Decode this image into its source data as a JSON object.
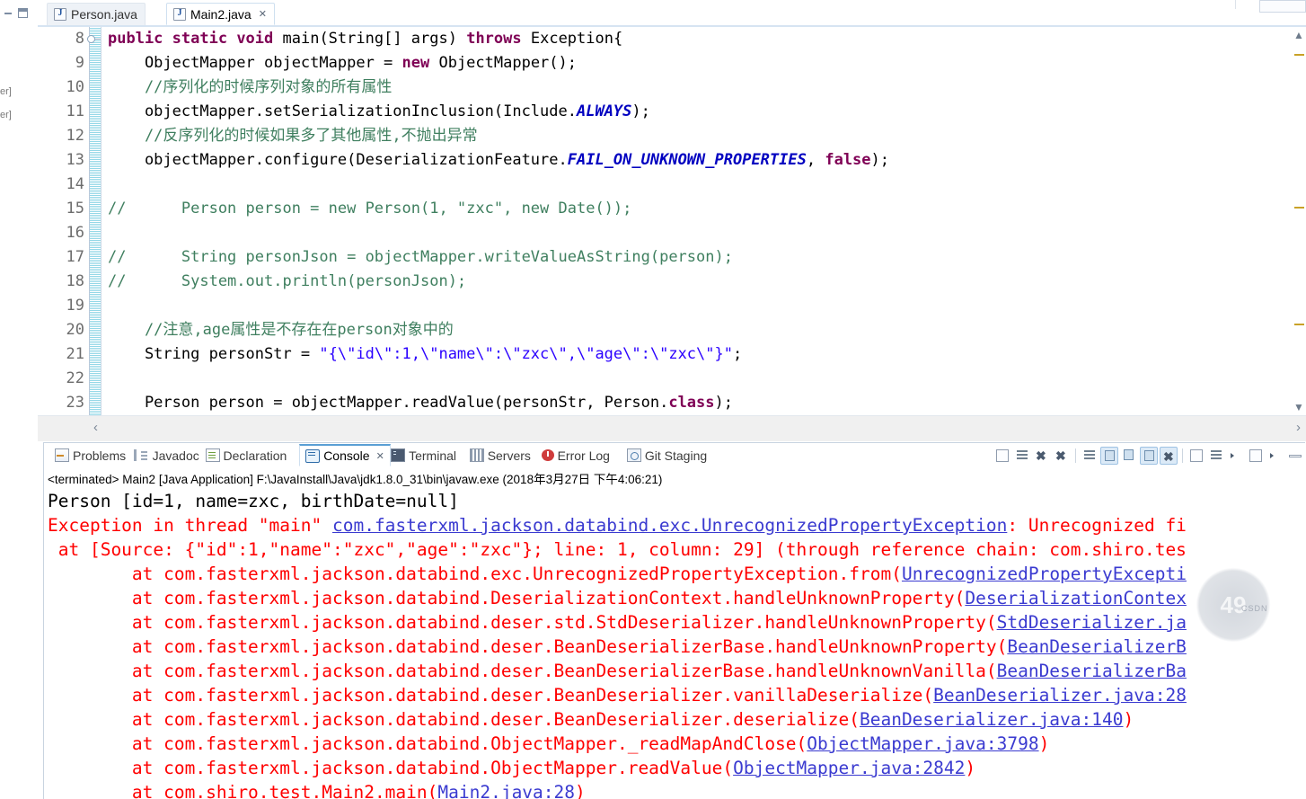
{
  "window": {
    "left_stubs": [
      "er]",
      "er]"
    ]
  },
  "editor_tabs": [
    {
      "label": "Person.java",
      "icon": "java-file-icon",
      "active": false,
      "closable": false
    },
    {
      "label": "Main2.java",
      "icon": "java-file-icon",
      "active": true,
      "closable": true,
      "close_glyph": "✕"
    }
  ],
  "code": {
    "first_visible_line": 8,
    "lines": [
      {
        "n": "8",
        "fold": true,
        "tokens": [
          {
            "t": "public ",
            "c": "kw"
          },
          {
            "t": "static ",
            "c": "kw"
          },
          {
            "t": "void ",
            "c": "kw"
          },
          {
            "t": "main(String[] args) ",
            "c": "plain"
          },
          {
            "t": "throws ",
            "c": "kw"
          },
          {
            "t": "Exception{",
            "c": "plain"
          }
        ]
      },
      {
        "n": "9",
        "fold": false,
        "tokens": [
          {
            "t": "    ObjectMapper objectMapper = ",
            "c": "plain"
          },
          {
            "t": "new ",
            "c": "kw"
          },
          {
            "t": "ObjectMapper();",
            "c": "plain"
          }
        ]
      },
      {
        "n": "10",
        "fold": false,
        "tokens": [
          {
            "t": "    //序列化的时候序列对象的所有属性",
            "c": "cmt"
          }
        ]
      },
      {
        "n": "11",
        "fold": false,
        "tokens": [
          {
            "t": "    objectMapper.setSerializationInclusion(Include.",
            "c": "plain"
          },
          {
            "t": "ALWAYS",
            "c": "cn"
          },
          {
            "t": ");",
            "c": "plain"
          }
        ]
      },
      {
        "n": "12",
        "fold": false,
        "tokens": [
          {
            "t": "    //反序列化的时候如果多了其他属性,不抛出异常",
            "c": "cmt"
          }
        ]
      },
      {
        "n": "13",
        "fold": false,
        "tokens": [
          {
            "t": "    objectMapper.configure(DeserializationFeature.",
            "c": "plain"
          },
          {
            "t": "FAIL_ON_UNKNOWN_PROPERTIES",
            "c": "cn"
          },
          {
            "t": ", ",
            "c": "plain"
          },
          {
            "t": "false",
            "c": "kw"
          },
          {
            "t": ");",
            "c": "plain"
          }
        ]
      },
      {
        "n": "14",
        "fold": false,
        "tokens": []
      },
      {
        "n": "15",
        "fold": false,
        "tokens": [
          {
            "t": "//      Person person = new Person(1, \"zxc\", new Date());",
            "c": "cmt"
          }
        ]
      },
      {
        "n": "16",
        "fold": false,
        "tokens": []
      },
      {
        "n": "17",
        "fold": false,
        "tokens": [
          {
            "t": "//      String personJson = objectMapper.writeValueAsString(person);",
            "c": "cmt"
          }
        ]
      },
      {
        "n": "18",
        "fold": false,
        "tokens": [
          {
            "t": "//      System.out.println(personJson);",
            "c": "cmt"
          }
        ]
      },
      {
        "n": "19",
        "fold": false,
        "tokens": []
      },
      {
        "n": "20",
        "fold": false,
        "tokens": [
          {
            "t": "    //注意,age属性是不存在在person对象中的",
            "c": "cmt"
          }
        ]
      },
      {
        "n": "21",
        "fold": false,
        "tokens": [
          {
            "t": "    String personStr = ",
            "c": "plain"
          },
          {
            "t": "\"{\\\"id\\\":1,\\\"name\\\":\\\"zxc\\\",\\\"age\\\":\\\"zxc\\\"}\"",
            "c": "str"
          },
          {
            "t": ";",
            "c": "plain"
          }
        ]
      },
      {
        "n": "22",
        "fold": false,
        "tokens": []
      },
      {
        "n": "23",
        "fold": false,
        "tokens": [
          {
            "t": "    Person person = objectMapper.readValue(personStr, Person.",
            "c": "plain"
          },
          {
            "t": "class",
            "c": "kw"
          },
          {
            "t": ");",
            "c": "plain"
          }
        ]
      }
    ],
    "hscroll_left_glyph": "‹",
    "hscroll_right_glyph": "›"
  },
  "console_panel": {
    "tabs": [
      {
        "label": "Problems",
        "icon": "problems-icon",
        "active": false
      },
      {
        "label": "Javadoc",
        "icon": "javadoc-icon",
        "active": false
      },
      {
        "label": "Declaration",
        "icon": "declaration-icon",
        "active": false
      },
      {
        "label": "Console",
        "icon": "console-icon",
        "active": true,
        "close_glyph": "✕"
      },
      {
        "label": "Terminal",
        "icon": "terminal-icon",
        "active": false
      },
      {
        "label": "Servers",
        "icon": "servers-icon",
        "active": false
      },
      {
        "label": "Error Log",
        "icon": "error-log-icon",
        "active": false
      },
      {
        "label": "Git Staging",
        "icon": "git-staging-icon",
        "active": false
      }
    ],
    "toolbar": [
      {
        "name": "new-console-view-icon",
        "selected": false
      },
      {
        "name": "clear-console-icon",
        "selected": false
      },
      {
        "name": "terminate-icon",
        "selected": false
      },
      {
        "name": "remove-all-terminated-icon",
        "selected": false
      },
      {
        "name": "separator",
        "selected": false
      },
      {
        "name": "scroll-lock-icon",
        "selected": false
      },
      {
        "name": "show-console-on-output-icon",
        "selected": true
      },
      {
        "name": "show-console-on-error-icon",
        "selected": false
      },
      {
        "name": "pin-console-icon",
        "selected": true
      },
      {
        "name": "close-console-icon",
        "selected": true
      },
      {
        "name": "separator",
        "selected": false
      },
      {
        "name": "open-console-icon",
        "selected": false
      },
      {
        "name": "display-selected-console-icon",
        "selected": false
      },
      {
        "name": "display-selected-console-dropdown-icon",
        "selected": false
      },
      {
        "name": "open-console-menu-icon",
        "selected": false
      },
      {
        "name": "view-menu-dropdown-icon",
        "selected": false
      },
      {
        "name": "minimize-icon",
        "selected": false
      }
    ],
    "launch_header": "<terminated> Main2 [Java Application] F:\\JavaInstall\\Java\\jdk1.8.0_31\\bin\\javaw.exe (2018年3月27日 下午4:06:21)",
    "output": [
      {
        "color": "black",
        "segments": [
          {
            "text": "Person [id=1, name=zxc, birthDate=null]",
            "link": false
          }
        ]
      },
      {
        "color": "red",
        "segments": [
          {
            "text": "Exception in thread \"main\" ",
            "link": false
          },
          {
            "text": "com.fasterxml.jackson.databind.exc.UnrecognizedPropertyException",
            "link": true
          },
          {
            "text": ": Unrecognized fi",
            "link": false
          }
        ]
      },
      {
        "color": "red",
        "segments": [
          {
            "text": " at [Source: {\"id\":1,\"name\":\"zxc\",\"age\":\"zxc\"}; line: 1, column: 29] (through reference chain: com.shiro.tes",
            "link": false
          }
        ]
      },
      {
        "color": "red",
        "segments": [
          {
            "text": "        at com.fasterxml.jackson.databind.exc.UnrecognizedPropertyException.from(",
            "link": false
          },
          {
            "text": "UnrecognizedPropertyExcepti",
            "link": true
          }
        ]
      },
      {
        "color": "red",
        "segments": [
          {
            "text": "        at com.fasterxml.jackson.databind.DeserializationContext.handleUnknownProperty(",
            "link": false
          },
          {
            "text": "DeserializationContex",
            "link": true
          }
        ]
      },
      {
        "color": "red",
        "segments": [
          {
            "text": "        at com.fasterxml.jackson.databind.deser.std.StdDeserializer.handleUnknownProperty(",
            "link": false
          },
          {
            "text": "StdDeserializer.ja",
            "link": true
          }
        ]
      },
      {
        "color": "red",
        "segments": [
          {
            "text": "        at com.fasterxml.jackson.databind.deser.BeanDeserializerBase.handleUnknownProperty(",
            "link": false
          },
          {
            "text": "BeanDeserializerB",
            "link": true
          }
        ]
      },
      {
        "color": "red",
        "segments": [
          {
            "text": "        at com.fasterxml.jackson.databind.deser.BeanDeserializerBase.handleUnknownVanilla(",
            "link": false
          },
          {
            "text": "BeanDeserializerBa",
            "link": true
          }
        ]
      },
      {
        "color": "red",
        "segments": [
          {
            "text": "        at com.fasterxml.jackson.databind.deser.BeanDeserializer.vanillaDeserialize(",
            "link": false
          },
          {
            "text": "BeanDeserializer.java:28",
            "link": true
          }
        ]
      },
      {
        "color": "red",
        "segments": [
          {
            "text": "        at com.fasterxml.jackson.databind.deser.BeanDeserializer.deserialize(",
            "link": false
          },
          {
            "text": "BeanDeserializer.java:140",
            "link": true
          },
          {
            "text": ")",
            "link": false
          }
        ]
      },
      {
        "color": "red",
        "segments": [
          {
            "text": "        at com.fasterxml.jackson.databind.ObjectMapper._readMapAndClose(",
            "link": false
          },
          {
            "text": "ObjectMapper.java:3798",
            "link": true
          },
          {
            "text": ")",
            "link": false
          }
        ]
      },
      {
        "color": "red",
        "segments": [
          {
            "text": "        at com.fasterxml.jackson.databind.ObjectMapper.readValue(",
            "link": false
          },
          {
            "text": "ObjectMapper.java:2842",
            "link": true
          },
          {
            "text": ")",
            "link": false
          }
        ]
      },
      {
        "color": "red",
        "segments": [
          {
            "text": "        at com.shiro.test.Main2.main(",
            "link": false
          },
          {
            "text": "Main2.java:28",
            "link": true
          },
          {
            "text": ")",
            "link": false
          }
        ]
      }
    ]
  },
  "watermark": {
    "text": "49",
    "subtext": "CSDN"
  },
  "colors": {
    "keyword": "#7f0055",
    "string": "#2a00ff",
    "comment": "#3f7f5f",
    "constant": "#0000c0",
    "console_error": "#ff0000",
    "link": "#0000cc",
    "tab_active_border": "#5a9fd4"
  }
}
